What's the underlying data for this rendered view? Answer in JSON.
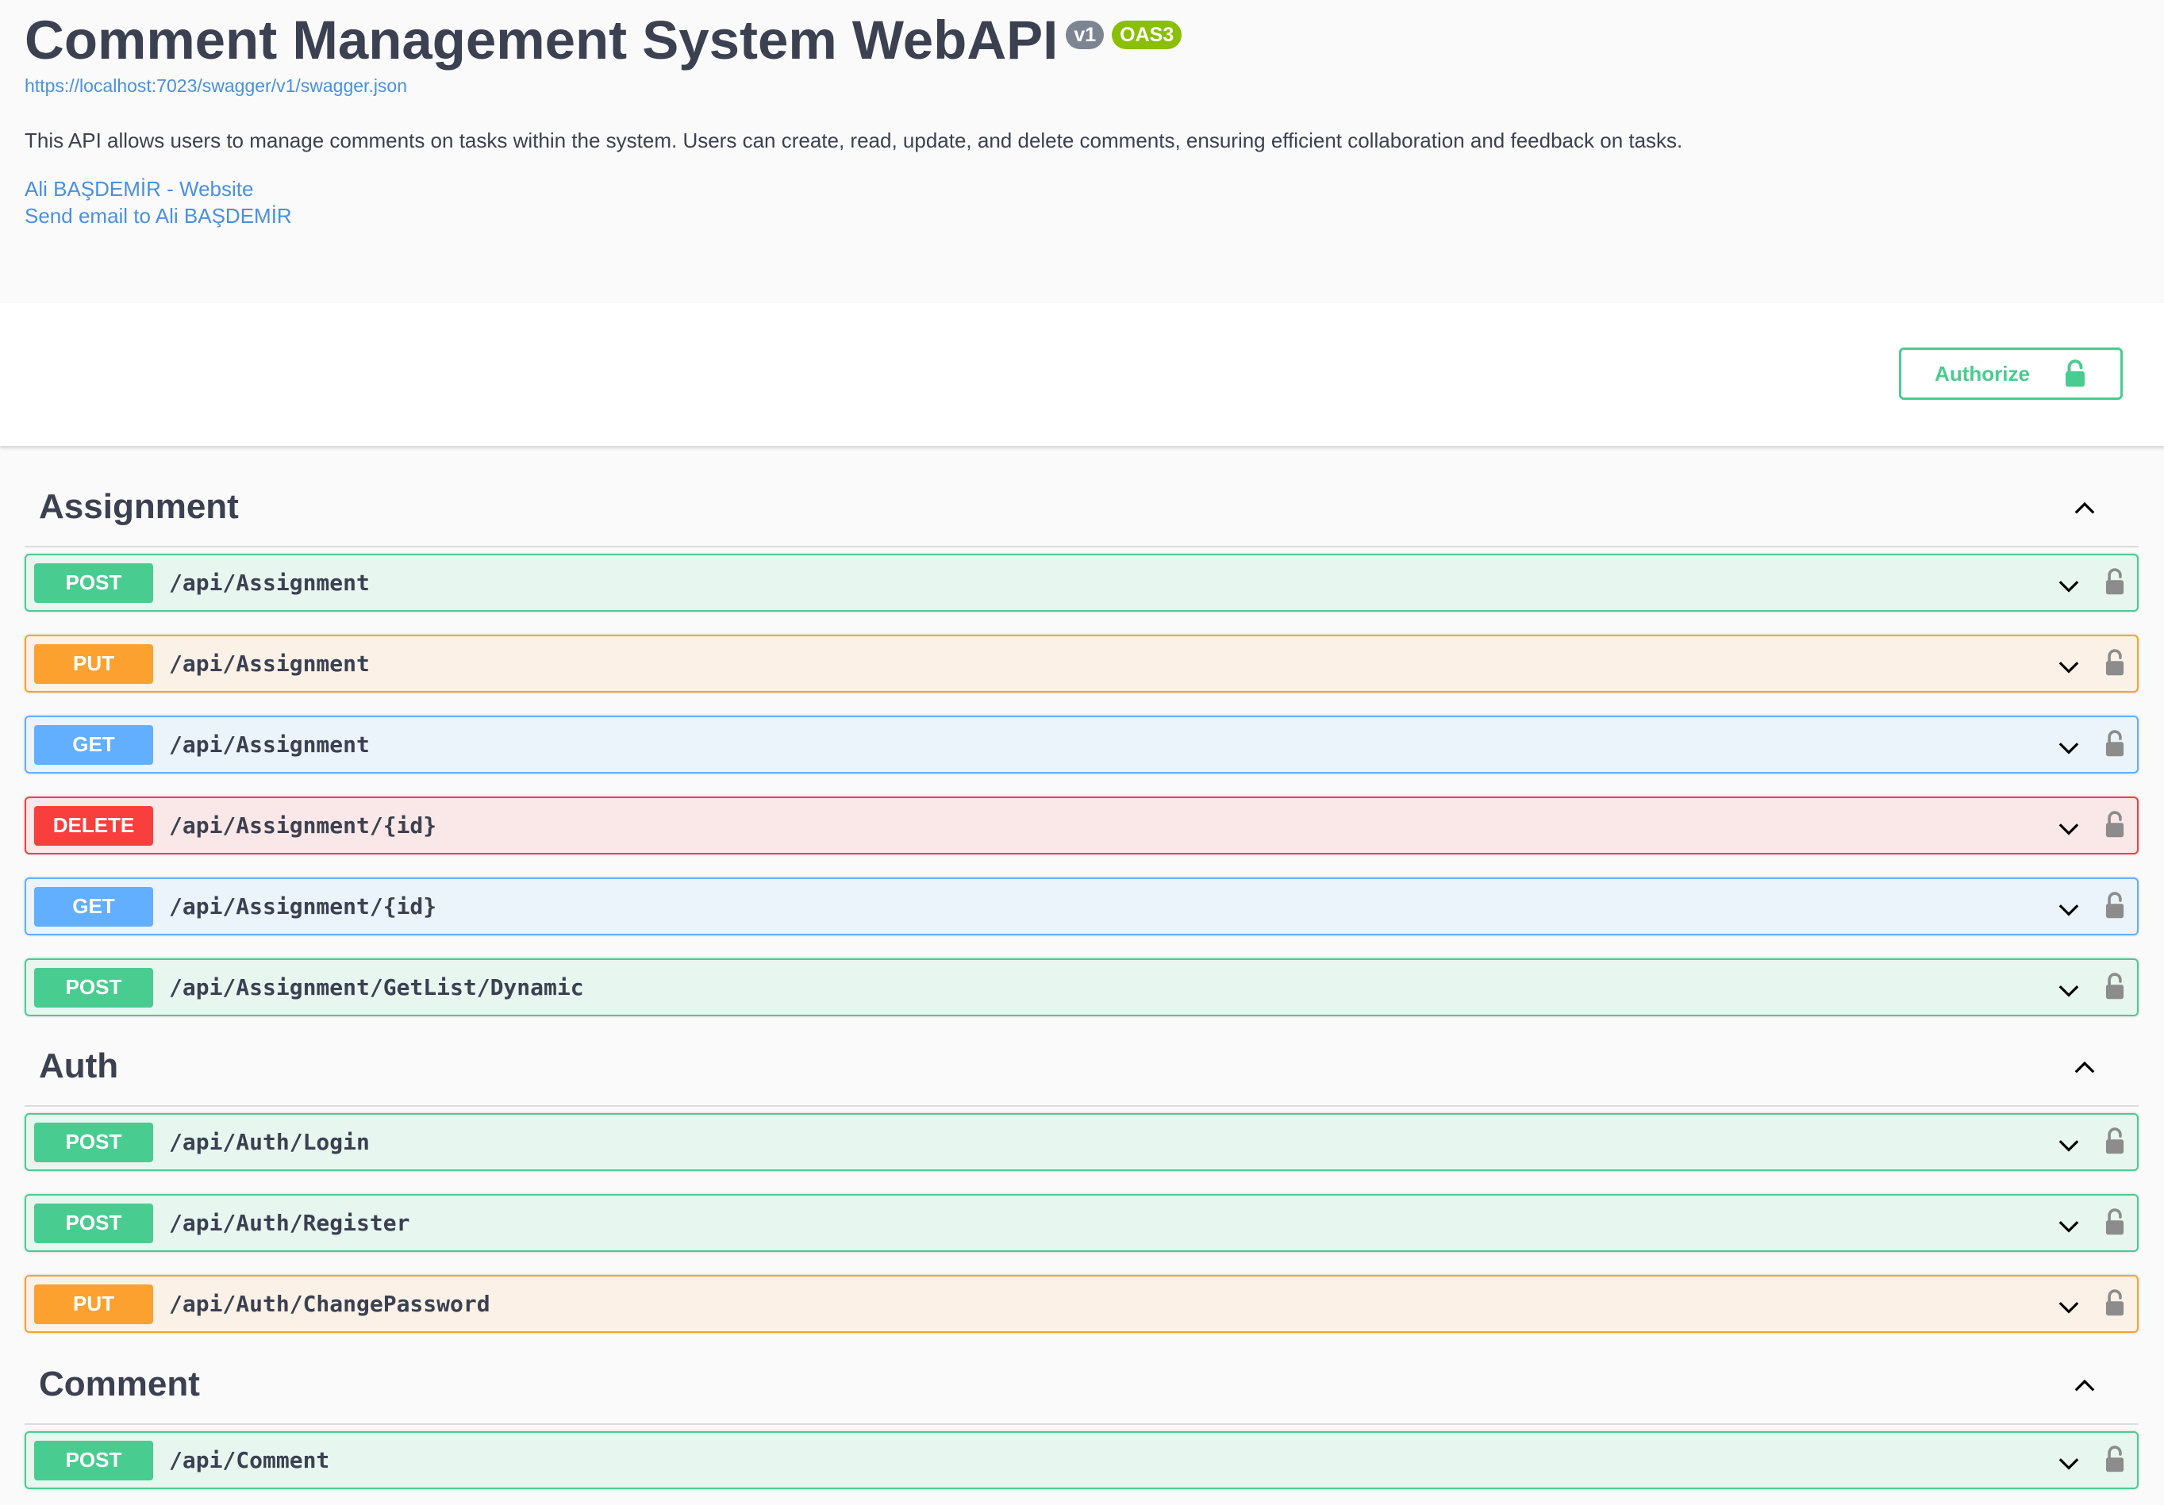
{
  "info": {
    "title": "Comment Management System WebAPI",
    "version_badge": "v1",
    "oas_badge": "OAS3",
    "spec_url": "https://localhost:7023/swagger/v1/swagger.json",
    "description": "This API allows users to manage comments on tasks within the system. Users can create, read, update, and delete comments, ensuring efficient collaboration and feedback on tasks.",
    "contact_website": "Ali BAŞDEMİR - Website",
    "contact_email": "Send email to Ali BAŞDEMİR"
  },
  "scheme": {
    "authorize_label": "Authorize"
  },
  "colors": {
    "post": "#49cc90",
    "put": "#fca130",
    "get": "#61affe",
    "delete": "#f93e3e",
    "link": "#4990e2"
  },
  "icons": {
    "authorize": "unlock-icon",
    "toggle_expanded": "chevron-up-icon",
    "op_expand": "chevron-down-icon",
    "op_lock": "lock-icon"
  },
  "tags": [
    {
      "name": "Assignment",
      "operations": [
        {
          "method": "POST",
          "path": "/api/Assignment"
        },
        {
          "method": "PUT",
          "path": "/api/Assignment"
        },
        {
          "method": "GET",
          "path": "/api/Assignment"
        },
        {
          "method": "DELETE",
          "path": "/api/Assignment/{id}"
        },
        {
          "method": "GET",
          "path": "/api/Assignment/{id}"
        },
        {
          "method": "POST",
          "path": "/api/Assignment/GetList/Dynamic"
        }
      ]
    },
    {
      "name": "Auth",
      "operations": [
        {
          "method": "POST",
          "path": "/api/Auth/Login"
        },
        {
          "method": "POST",
          "path": "/api/Auth/Register"
        },
        {
          "method": "PUT",
          "path": "/api/Auth/ChangePassword"
        }
      ]
    },
    {
      "name": "Comment",
      "operations": [
        {
          "method": "POST",
          "path": "/api/Comment"
        }
      ]
    }
  ]
}
